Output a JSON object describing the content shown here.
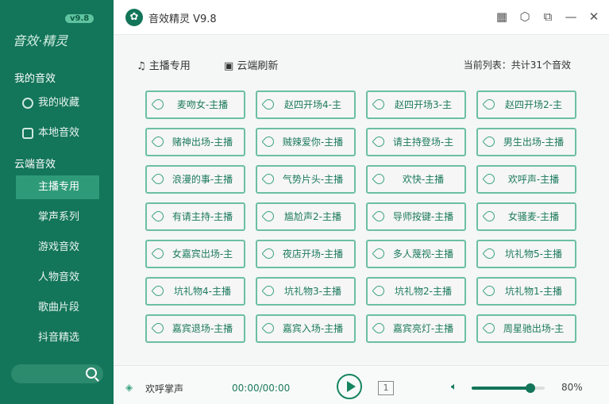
{
  "app": {
    "title": "音效精灵 V9.8",
    "logo_text": "音效·精灵",
    "logo_version": "v9.8"
  },
  "sidebar": {
    "section_mine": "我的音效",
    "mine_items": [
      {
        "label": "我的收藏",
        "icon": "star-icon"
      },
      {
        "label": "本地音效",
        "icon": "folder-icon"
      }
    ],
    "section_cloud": "云端音效",
    "cloud_items": [
      {
        "label": "主播专用",
        "active": true
      },
      {
        "label": "掌声系列"
      },
      {
        "label": "游戏音效"
      },
      {
        "label": "人物音效"
      },
      {
        "label": "歌曲片段"
      },
      {
        "label": "抖音精选"
      }
    ]
  },
  "toolbar": {
    "category": "主播专用",
    "refresh": "云端刷新",
    "count": "当前列表：共计31个音效"
  },
  "sounds": [
    "麦吻女-主播",
    "赵四开场4-主",
    "赵四开场3-主",
    "赵四开场2-主",
    "赌神出场-主播",
    "贼辣爱你-主播",
    "请主持登场-主",
    "男生出场-主播",
    "浪漫的事-主播",
    "气势片头-主播",
    "欢快-主播",
    "欢呼声-主播",
    "有请主持-主播",
    "尴尬声2-主播",
    "导师按键-主播",
    "女骚麦-主播",
    "女嘉宾出场-主",
    "夜店开场-主播",
    "多人蔑视-主播",
    "坑礼物5-主播",
    "坑礼物4-主播",
    "坑礼物3-主播",
    "坑礼物2-主播",
    "坑礼物1-主播",
    "嘉宾退场-主播",
    "嘉宾入场-主播",
    "嘉宾亮灯-主播",
    "周星驰出场-主"
  ],
  "player": {
    "current": "欢呼掌声",
    "time": "00:00/00:00",
    "loop": "1",
    "volume_percent": 80,
    "volume_label": "80%"
  },
  "colors": {
    "primary": "#137559",
    "accent": "#6cbfa2"
  }
}
